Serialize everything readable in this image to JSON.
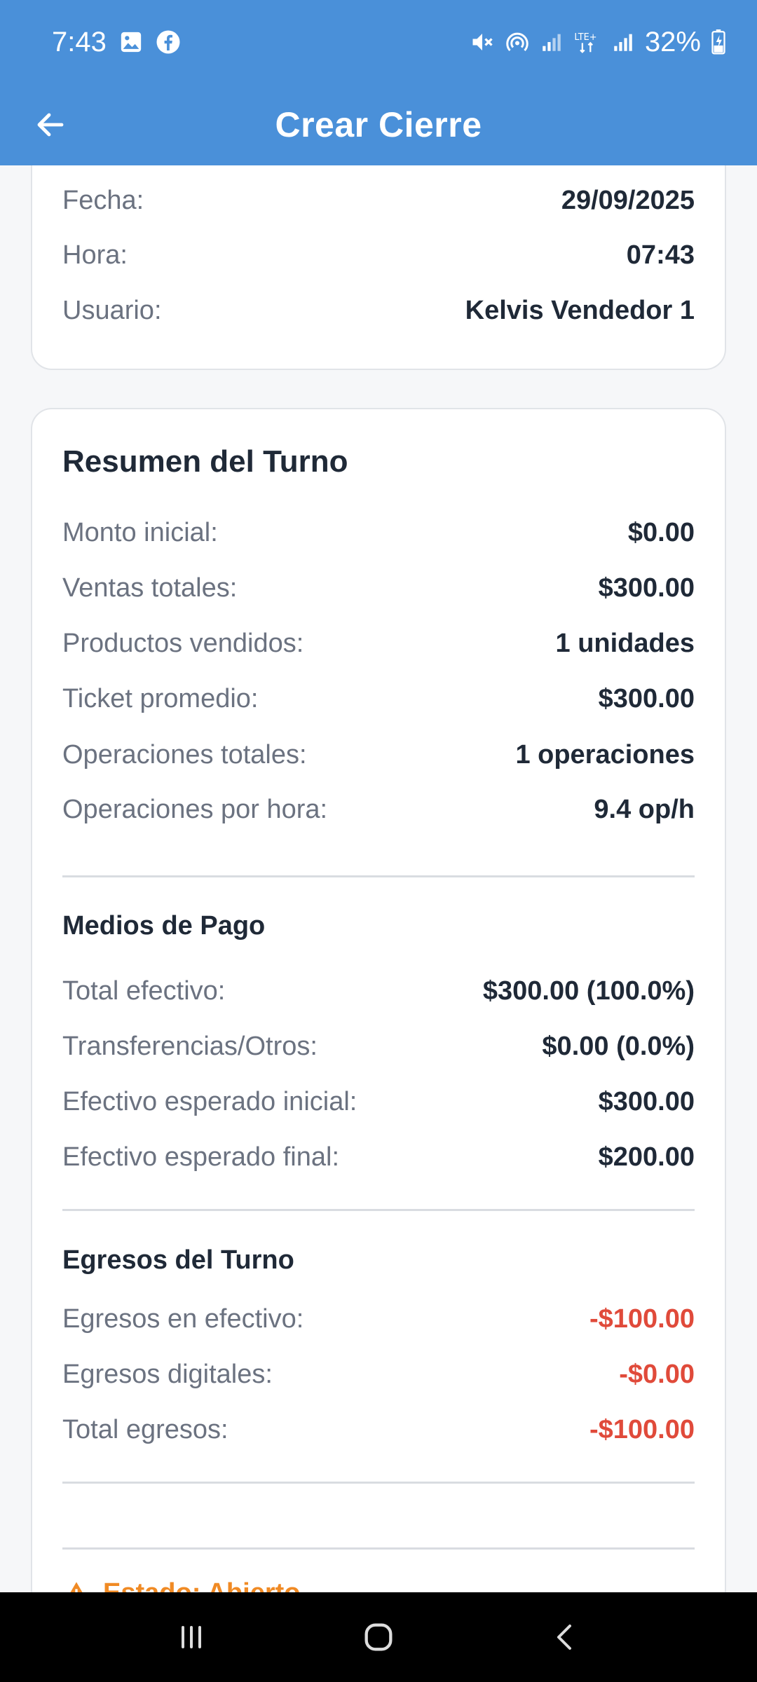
{
  "status_bar": {
    "time": "7:43",
    "battery": "32%",
    "icons": [
      "gallery-icon",
      "facebook-icon",
      "mute-icon",
      "hotspot-icon",
      "signal-icon",
      "lte-icon",
      "signal-icon",
      "battery-icon"
    ]
  },
  "app_bar": {
    "title": "Crear Cierre"
  },
  "info": {
    "rows": [
      {
        "label": "Fecha:",
        "value": "29/09/2025"
      },
      {
        "label": "Hora:",
        "value": "07:43"
      },
      {
        "label": "Usuario:",
        "value": "Kelvis Vendedor 1"
      }
    ]
  },
  "summary": {
    "title": "Resumen del Turno",
    "rows": [
      {
        "label": "Monto inicial:",
        "value": "$0.00"
      },
      {
        "label": "Ventas totales:",
        "value": "$300.00"
      },
      {
        "label": "Productos vendidos:",
        "value": "1 unidades"
      },
      {
        "label": "Ticket promedio:",
        "value": "$300.00"
      },
      {
        "label": "Operaciones totales:",
        "value": "1 operaciones"
      },
      {
        "label": "Operaciones por hora:",
        "value": "9.4 op/h"
      }
    ],
    "payments": {
      "title": "Medios de Pago",
      "rows": [
        {
          "label": "Total efectivo:",
          "value": "$300.00 (100.0%)"
        },
        {
          "label": "Transferencias/Otros:",
          "value": "$0.00 (0.0%)"
        },
        {
          "label": "Efectivo esperado inicial:",
          "value": "$300.00"
        },
        {
          "label": "Efectivo esperado final:",
          "value": "$200.00"
        }
      ]
    },
    "expenses": {
      "title": "Egresos del Turno",
      "rows": [
        {
          "label": "Egresos en efectivo:",
          "value": "-$100.00"
        },
        {
          "label": "Egresos digitales:",
          "value": "-$0.00"
        },
        {
          "label": "Total egresos:",
          "value": "-$100.00"
        }
      ]
    },
    "estado": "Estado: Abierto"
  },
  "colors": {
    "primary": "#4a90d9",
    "negative": "#e04a3a",
    "warning": "#f08a24"
  }
}
